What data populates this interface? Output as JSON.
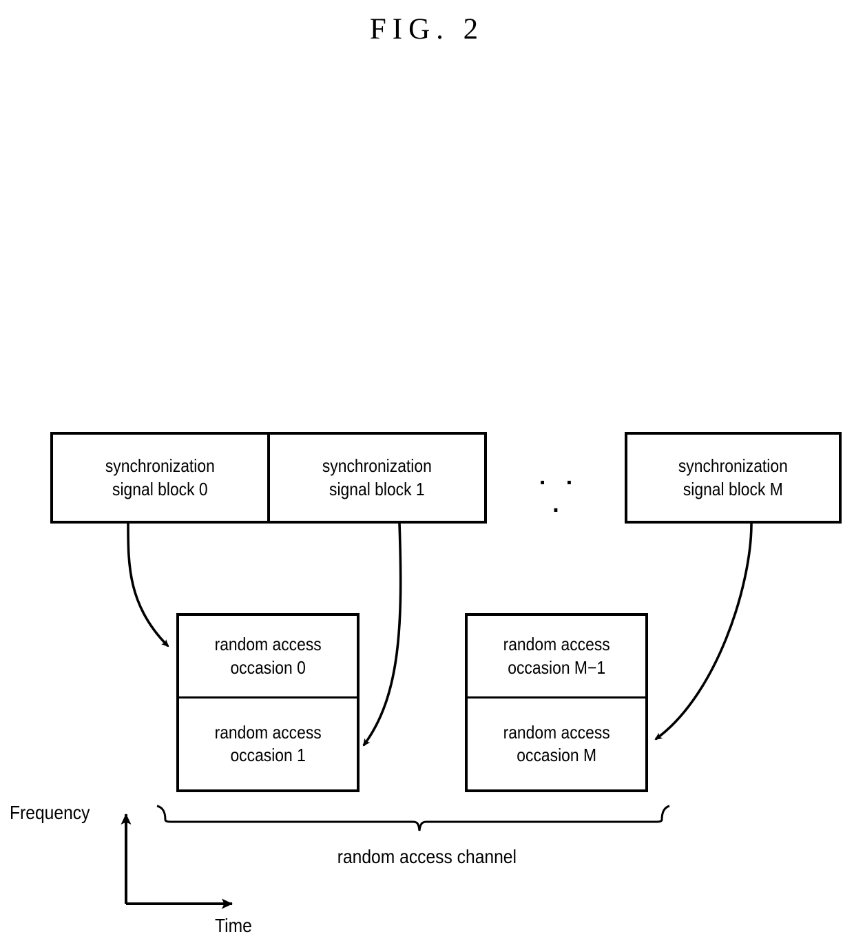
{
  "figure": {
    "title": "FIG. 2"
  },
  "sync_blocks": [
    {
      "id": "ssb-0",
      "line1": "synchronization",
      "line2": "signal block 0"
    },
    {
      "id": "ssb-1",
      "line1": "synchronization",
      "line2": "signal block 1"
    },
    {
      "id": "ssb-m",
      "line1": "synchronization",
      "line2": "signal block M"
    }
  ],
  "ellipsis": ". . .",
  "random_access_occasions": [
    {
      "id": "rao-0",
      "line1": "random access",
      "line2": "occasion 0"
    },
    {
      "id": "rao-1",
      "line1": "random access",
      "line2": "occasion 1"
    },
    {
      "id": "rao-m1",
      "line1": "random access",
      "line2": "occasion M−1"
    },
    {
      "id": "rao-m",
      "line1": "random access",
      "line2": "occasion M"
    }
  ],
  "brace": {
    "label": "random access channel"
  },
  "axes": {
    "y_label": "Frequency",
    "x_label": "Time"
  },
  "colors": {
    "stroke": "#000000",
    "background": "#ffffff"
  }
}
